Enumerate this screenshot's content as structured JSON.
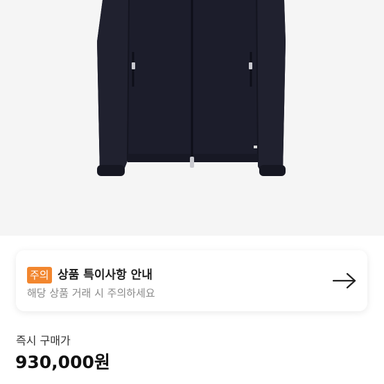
{
  "product": {
    "image_icon": "jacket-image",
    "background_color": "#f5f5f5"
  },
  "notice": {
    "badge": "주의",
    "title": "상품 특이사항 안내",
    "subtitle": "해당 상품 거래 시 주의하세요",
    "action_icon": "arrow-right-icon",
    "badge_color": "#f2862e"
  },
  "price": {
    "label": "즉시 구매가",
    "value": "930,000원"
  }
}
